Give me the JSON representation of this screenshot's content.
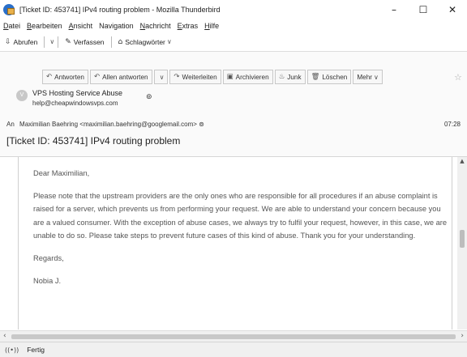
{
  "window": {
    "title": "[Ticket ID: 453741] IPv4 routing problem - Mozilla Thunderbird",
    "minimize": "–",
    "maximize": "☐",
    "close": "✕"
  },
  "menubar": {
    "items": [
      {
        "u": "D",
        "rest": "atei"
      },
      {
        "u": "B",
        "rest": "earbeiten"
      },
      {
        "u": "A",
        "rest": "nsicht"
      },
      {
        "u": "N",
        "rest": "avigation",
        "pre": "Na",
        "label": "Navigation"
      },
      {
        "u": "N",
        "rest": "achricht"
      },
      {
        "u": "E",
        "rest": "xtras"
      },
      {
        "u": "H",
        "rest": "ilfe"
      }
    ]
  },
  "toolbar": {
    "abrufen": "Abrufen",
    "verfassen": "Verfassen",
    "schlagwoerter": "Schlagwörter"
  },
  "actions": {
    "antworten": "Antworten",
    "allen_antworten": "Allen antworten",
    "weiterleiten": "Weiterleiten",
    "archivieren": "Archivieren",
    "junk": "Junk",
    "loeschen": "Löschen",
    "mehr": "Mehr"
  },
  "message": {
    "from_name": "VPS Hosting Service Abuse",
    "from_email": "help@cheapwindowsvps.com",
    "to_label": "An",
    "to_value": "Maximilian Baehring <maximilian.baehring@googlemail.com>",
    "time": "07:28",
    "subject": "[Ticket ID: 453741] IPv4 routing problem",
    "avatar_letter": "V"
  },
  "body": {
    "greeting": "Dear Maximilian,",
    "paragraph": "Please note that the upstream providers are the only ones who are responsible for all procedures if an abuse complaint is raised for a server, which prevents us from performing your request. We are able to understand your concern because you are a valued consumer. With the exception of abuse cases, we always try to fulfil your request, however, in this case, we are unable to do so. Please take steps to prevent future cases of this kind of abuse. Thank you for your understanding.",
    "closing": "Regards,",
    "signature": "Nobia J."
  },
  "status": {
    "text": "Fertig"
  }
}
